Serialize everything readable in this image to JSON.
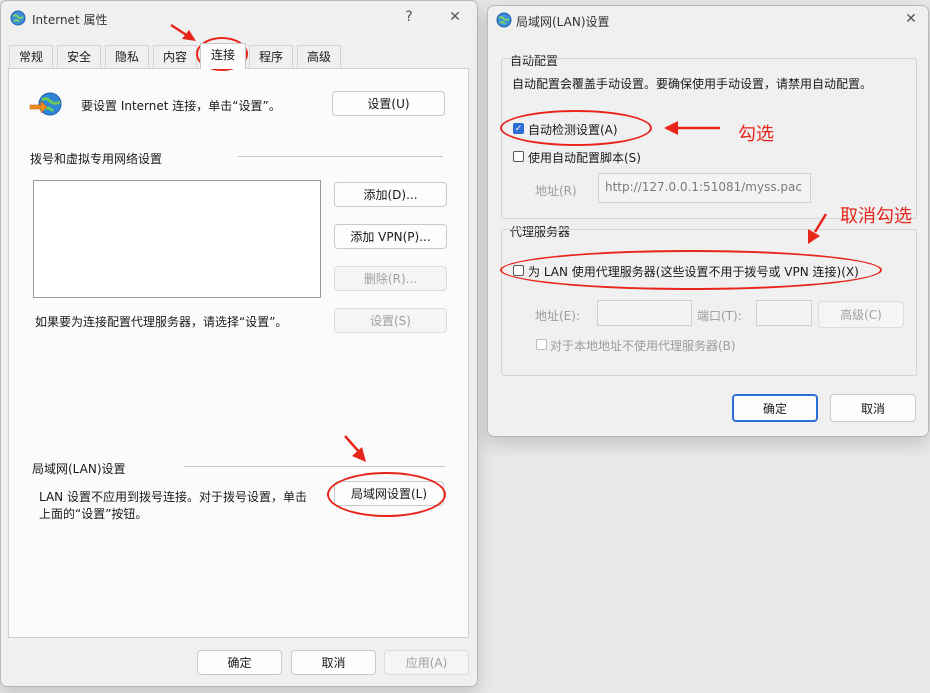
{
  "left_window": {
    "title": "Internet 属性",
    "help_glyph": "?",
    "close_glyph": "✕",
    "tabs": [
      {
        "label": "常规"
      },
      {
        "label": "安全"
      },
      {
        "label": "隐私"
      },
      {
        "label": "内容"
      },
      {
        "label": "连接",
        "active": true
      },
      {
        "label": "程序"
      },
      {
        "label": "高级"
      }
    ],
    "setup_text": "要设置 Internet 连接，单击“设置”。",
    "setup_button": "设置(U)",
    "dialup_group": "拨号和虚拟专用网络设置",
    "add_button": "添加(D)...",
    "add_vpn_button": "添加 VPN(P)...",
    "delete_button": "删除(R)...",
    "proxy_hint": "如果要为连接配置代理服务器，请选择“设置”。",
    "settings_button": "设置(S)",
    "lan_group": "局域网(LAN)设置",
    "lan_text_line1": "LAN 设置不应用到拨号连接。对于拨号设置，单击",
    "lan_text_line2": "上面的“设置”按钮。",
    "lan_button": "局域网设置(L)",
    "ok_button": "确定",
    "cancel_button": "取消",
    "apply_button": "应用(A)"
  },
  "right_window": {
    "title": "局域网(LAN)设置",
    "close_glyph": "✕",
    "auto_config_group": "自动配置",
    "auto_config_desc": "自动配置会覆盖手动设置。要确保使用手动设置，请禁用自动配置。",
    "auto_detect_label": "自动检测设置(A)",
    "auto_detect_checked": true,
    "auto_script_label": "使用自动配置脚本(S)",
    "auto_script_checked": false,
    "address_label": "地址(R)",
    "address_value": "http://127.0.0.1:51081/myss.pac",
    "proxy_group": "代理服务器",
    "use_proxy_label": "为 LAN 使用代理服务器(这些设置不用于拨号或 VPN 连接)(X)",
    "use_proxy_checked": false,
    "proxy_address_label": "地址(E):",
    "proxy_port_label": "端口(T):",
    "advanced_button": "高级(C)",
    "bypass_local_label": "对于本地地址不使用代理服务器(B)",
    "ok_button": "确定",
    "cancel_button": "取消"
  },
  "annotations": {
    "check_note": "勾选",
    "uncheck_note": "取消勾选",
    "color": "#e8251b"
  }
}
